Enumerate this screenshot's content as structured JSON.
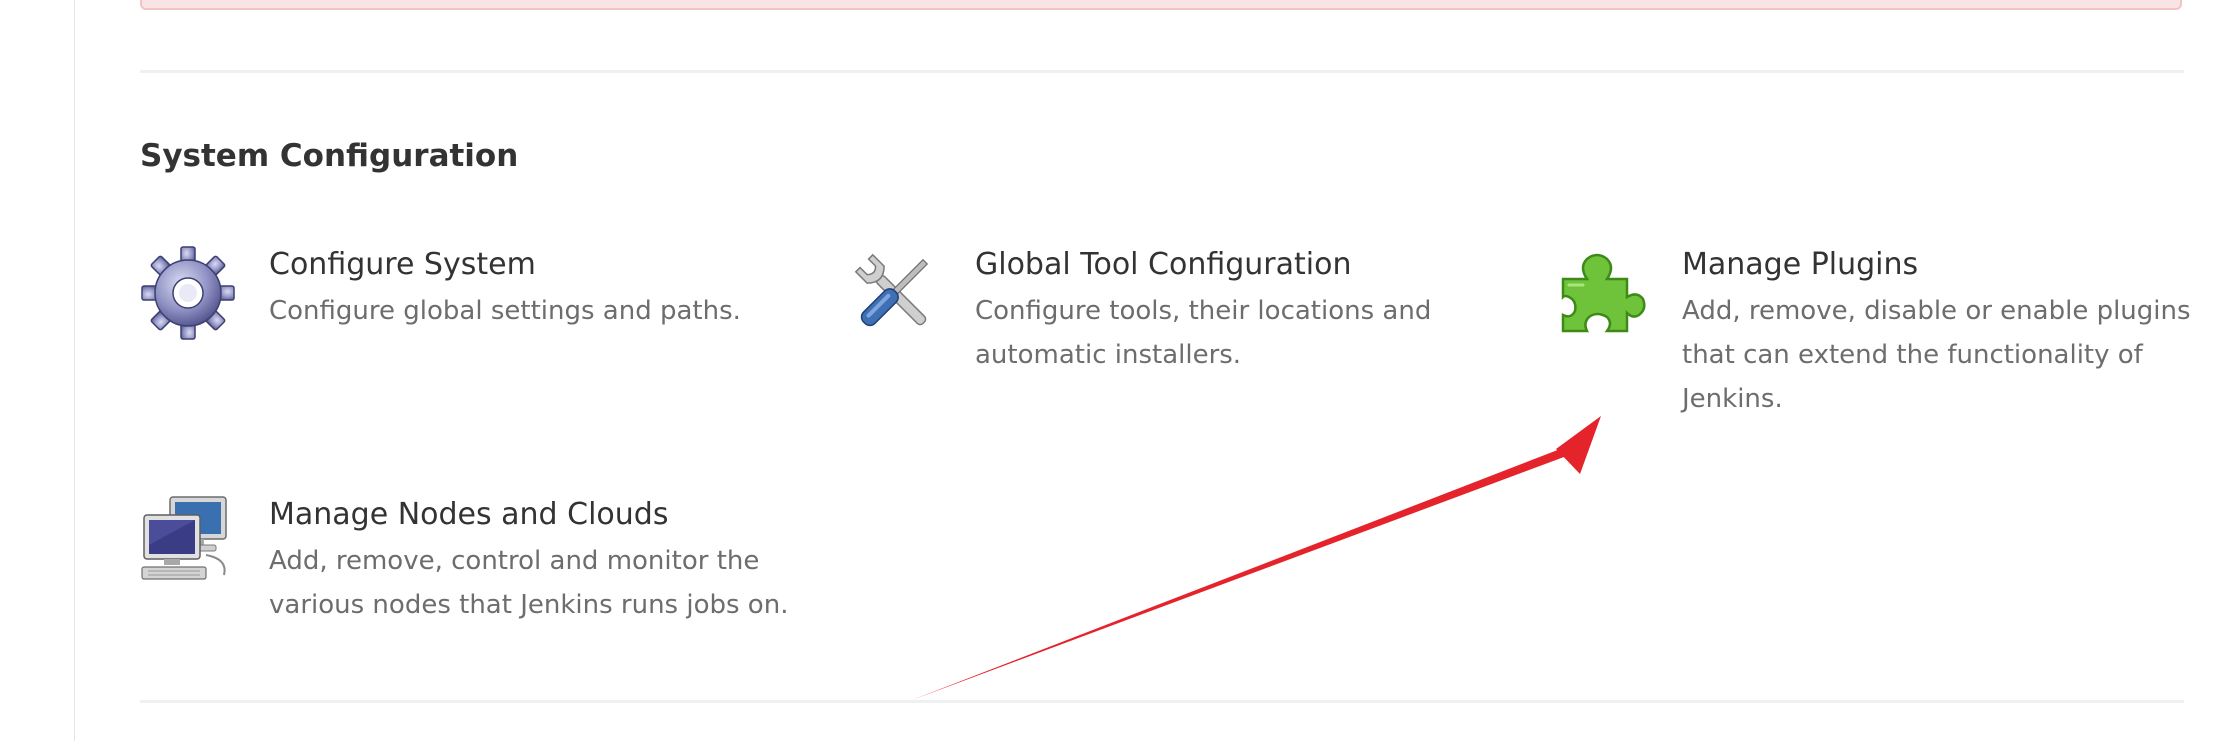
{
  "section": {
    "title": "System Configuration"
  },
  "tiles": [
    {
      "title": "Configure System",
      "description": "Configure global settings and paths."
    },
    {
      "title": "Global Tool Configuration",
      "description": "Configure tools, their locations and automatic installers."
    },
    {
      "title": "Manage Plugins",
      "description": "Add, remove, disable or enable plugins that can extend the functionality of Jenkins."
    },
    {
      "title": "Manage Nodes and Clouds",
      "description": "Add, remove, control and monitor the various nodes that Jenkins runs jobs on."
    }
  ],
  "colors": {
    "alert_background": "#fae3e5",
    "plugin_icon_green": "#6fc33b",
    "gear_icon_purple": "#8d8fc2",
    "annotation_arrow": "#e4232b"
  },
  "icons": [
    "gear-icon",
    "tools-icon",
    "puzzle-piece-icon",
    "computers-icon"
  ]
}
